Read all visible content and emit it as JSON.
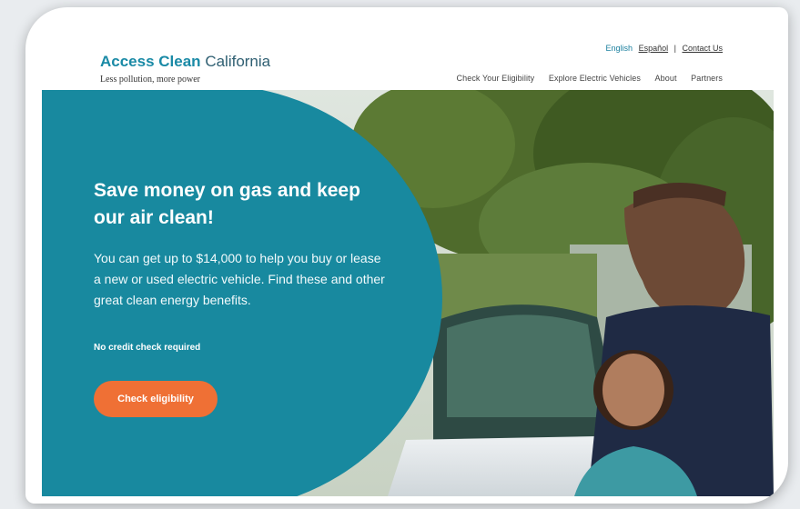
{
  "header": {
    "logo_title_bold": "Access Clean",
    "logo_title_light": "California",
    "logo_tagline": "Less pollution, more power",
    "languages": [
      "English",
      "Español"
    ],
    "separator": "|",
    "contact_label": "Contact Us",
    "nav": [
      "Check Your Eligibility",
      "Explore Electric Vehicles",
      "About",
      "Partners"
    ]
  },
  "hero": {
    "headline": "Save money on gas and keep our air clean!",
    "body": "You can get up to $14,000 to help you buy or lease a new or used electric vehicle. Find these and other great clean energy benefits.",
    "note": "No credit check required",
    "cta_label": "Check eligibility"
  },
  "colors": {
    "brand_teal": "#18899f",
    "cta_orange": "#ef7035"
  }
}
